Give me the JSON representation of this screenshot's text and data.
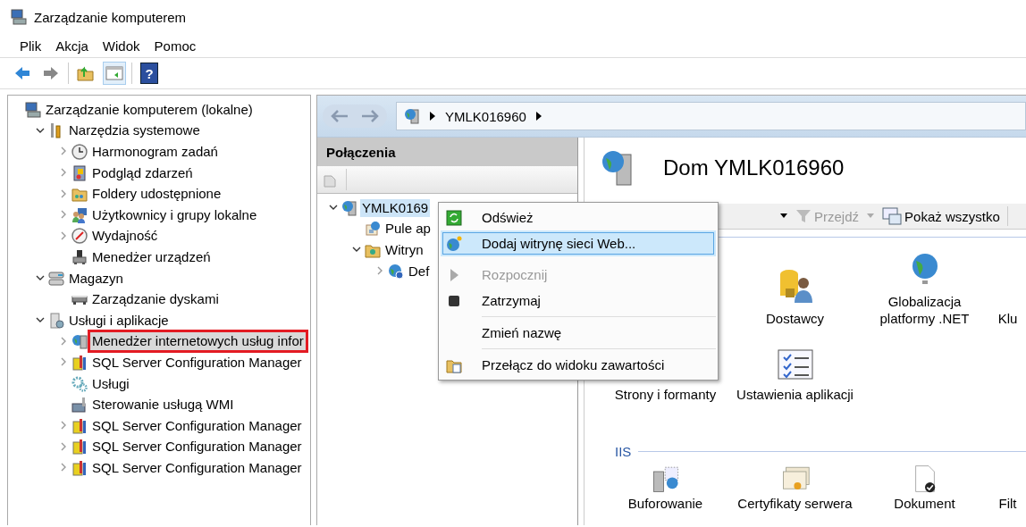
{
  "window": {
    "title": "Zarządzanie komputerem"
  },
  "menu_bar": [
    "Plik",
    "Akcja",
    "Widok",
    "Pomoc"
  ],
  "toolbar": [
    {
      "kind": "back",
      "disabled": false
    },
    {
      "kind": "forward",
      "disabled": true
    },
    {
      "kind": "separator"
    },
    {
      "kind": "up"
    },
    {
      "kind": "console-tree",
      "pressed": true
    },
    {
      "kind": "separator"
    },
    {
      "kind": "help",
      "label": "?"
    }
  ],
  "console_tree": [
    {
      "label": "Zarządzanie komputerem (lokalne)",
      "selected": false,
      "children": [
        {
          "label": "Narzędzia systemowe",
          "selected": false,
          "expanded": true,
          "children": [
            {
              "label": "Harmonogram zadań",
              "selected": false,
              "expanded": false
            },
            {
              "label": "Podgląd zdarzeń",
              "selected": false,
              "expanded": false
            },
            {
              "label": "Foldery udostępnione",
              "selected": false,
              "expanded": false
            },
            {
              "label": "Użytkownicy i grupy lokalne",
              "selected": false,
              "expanded": false
            },
            {
              "label": "Wydajność",
              "selected": false,
              "expanded": false
            },
            {
              "label": "Menedżer urządzeń",
              "selected": false
            }
          ]
        },
        {
          "label": "Magazyn",
          "selected": false,
          "expanded": true,
          "children": [
            {
              "label": "Zarządzanie dyskami",
              "selected": false
            }
          ]
        },
        {
          "label": "Usługi i aplikacje",
          "selected": false,
          "expanded": true,
          "children": [
            {
              "label": "Menedżer internetowych usług infor",
              "selected": true,
              "highlighted": true,
              "expanded": false
            },
            {
              "label": "SQL Server Configuration Manager",
              "selected": false,
              "expanded": false
            },
            {
              "label": "Usługi",
              "selected": false
            },
            {
              "label": "Sterowanie usługą WMI",
              "selected": false
            },
            {
              "label": "SQL Server Configuration Manager",
              "selected": false,
              "expanded": false
            },
            {
              "label": "SQL Server Configuration Manager",
              "selected": false,
              "expanded": false
            },
            {
              "label": "SQL Server Configuration Manager",
              "selected": false,
              "expanded": false
            }
          ]
        }
      ]
    }
  ],
  "iis": {
    "nav": {
      "back_disabled": true,
      "forward_disabled": true,
      "path": [
        "YMLK016960"
      ]
    },
    "connections": {
      "title": "Połączenia",
      "tree": [
        {
          "label": "YMLK0169",
          "selected": true,
          "expanded": true,
          "children": [
            {
              "label": "Pule ap",
              "selected": false
            },
            {
              "label": "Witryn",
              "selected": false,
              "expanded": true,
              "children": [
                {
                  "label": "Def",
                  "selected": false,
                  "expanded": false
                }
              ]
            }
          ]
        }
      ]
    },
    "home": {
      "title": "Dom YMLK016960",
      "filter": {
        "go": {
          "label": "Przejdź",
          "disabled": true
        },
        "show_all": {
          "label": "Pokaż wszystko",
          "disabled": false
        }
      },
      "groups": [
        {
          "rows": [
            [
              null,
              {
                "label": "Dostawcy"
              },
              {
                "label": "Globalizacja platformy .NET"
              },
              {
                "label": "Klu"
              }
            ],
            [
              {
                "label": "Strony i formanty"
              },
              {
                "label": "Ustawienia aplikacji"
              }
            ]
          ]
        },
        {
          "title": "IIS",
          "rows": [
            [
              {
                "label": "Buforowanie"
              },
              {
                "label": "Certyfikaty serwera"
              },
              {
                "label": "Dokument"
              },
              {
                "label": "Filt"
              }
            ]
          ]
        }
      ]
    }
  },
  "context_menu": [
    {
      "kind": "item",
      "label": "Odśwież",
      "disabled": false,
      "selected": false,
      "highlighted": false
    },
    {
      "kind": "item",
      "label": "Dodaj witrynę sieci Web...",
      "disabled": false,
      "selected": true,
      "highlighted": true
    },
    {
      "kind": "gap"
    },
    {
      "kind": "item",
      "label": "Rozpocznij",
      "disabled": true,
      "selected": false,
      "highlighted": false
    },
    {
      "kind": "item",
      "label": "Zatrzymaj",
      "disabled": false,
      "selected": false,
      "highlighted": false
    },
    {
      "kind": "separator"
    },
    {
      "kind": "item",
      "label": "Zmień nazwę",
      "disabled": false,
      "selected": false,
      "highlighted": false
    },
    {
      "kind": "separator"
    },
    {
      "kind": "item",
      "label": "Przełącz do widoku zawartości",
      "disabled": false,
      "selected": false,
      "highlighted": false
    }
  ]
}
